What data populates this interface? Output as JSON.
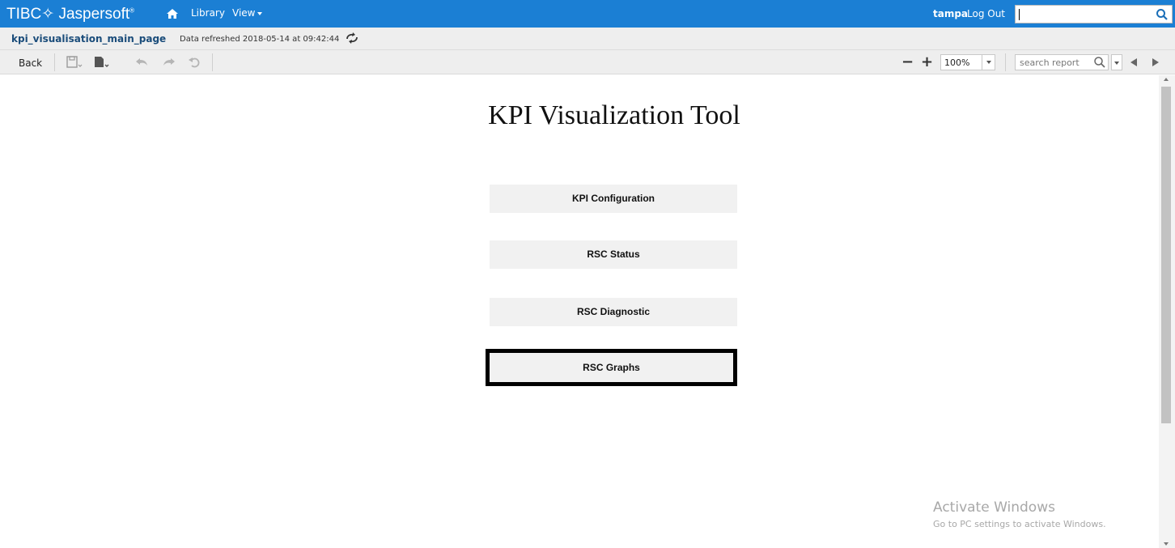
{
  "topbar": {
    "logo_text": "TIBC✧ Jaspersoft",
    "logo_reg": "®",
    "home_icon": "home-icon",
    "library_label": "Library",
    "view_label": "View",
    "user": "tampa",
    "logout_label": "Log Out",
    "search_value": "",
    "search_icon": "search-icon",
    "bg_color": "#1b7fd4"
  },
  "titlebar": {
    "report_name": "kpi_visualisation_main_page",
    "refreshed_text": "Data refreshed 2018-05-14 at 09:42:44",
    "refresh_icon": "refresh-icon"
  },
  "toolbar": {
    "back_label": "Back",
    "icons": [
      "save-icon",
      "export-icon",
      "undo-icon",
      "redo-icon",
      "undo-all-icon"
    ],
    "zoom_out": "−",
    "zoom_in": "+",
    "zoom_value": "100%",
    "search_placeholder": "search report"
  },
  "main": {
    "title": "KPI Visualization Tool",
    "buttons": [
      {
        "label": "KPI Configuration"
      },
      {
        "label": "RSC Status"
      },
      {
        "label": "RSC Diagnostic"
      },
      {
        "label": "RSC Graphs"
      }
    ]
  },
  "watermark": {
    "line1": "Activate Windows",
    "line2": "Go to PC settings to activate Windows."
  }
}
